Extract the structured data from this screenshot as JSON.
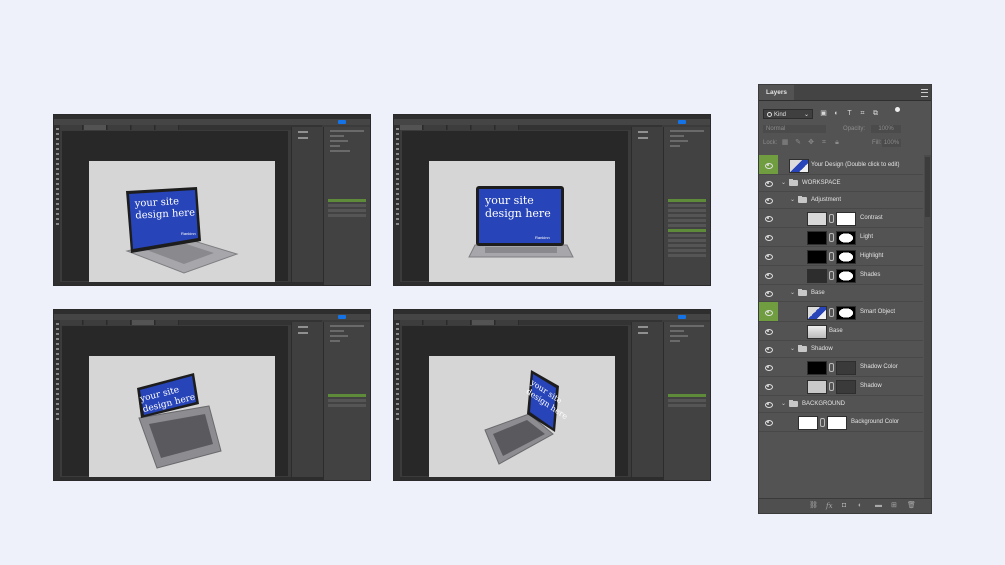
{
  "mockups": [
    {
      "screen_line1": "your site",
      "screen_line2": "design here",
      "brand": "Rankinn",
      "tilt": 0
    },
    {
      "screen_line1": "your site",
      "screen_line2": "design here",
      "brand": "Rankinn",
      "tilt": 0
    },
    {
      "screen_line1": "your site",
      "screen_line2": "design here",
      "brand": "",
      "tilt": 0
    },
    {
      "screen_line1": "your site",
      "screen_line2": "design here",
      "brand": "",
      "tilt": 0
    }
  ],
  "layers_panel": {
    "tab_title": "Layers",
    "filter_kind": "Kind",
    "blend_mode": "Normal",
    "opacity_label": "Opacity:",
    "opacity_value": "100%",
    "lock_label": "Lock:",
    "fill_label": "Fill:",
    "fill_value": "100%",
    "icons": {
      "menu": "panel-menu-icon",
      "search": "search-icon",
      "filter_pixel": "image-icon",
      "filter_adjust": "adjustment-icon",
      "filter_type": "type-icon",
      "filter_shape": "shape-icon",
      "filter_smart": "smart-object-icon"
    },
    "layers": [
      {
        "name": "Your Design  (Double click to edit)",
        "type": "smart",
        "depth": 0,
        "selected": true,
        "thumb": "design"
      },
      {
        "name": "WORKSPACE",
        "type": "group",
        "depth": 0,
        "selected": false
      },
      {
        "name": "Adjustment",
        "type": "group",
        "depth": 1,
        "selected": false
      },
      {
        "name": "Contrast",
        "type": "adjustment",
        "depth": 2,
        "selected": false,
        "thumb": "curves",
        "mask": "white"
      },
      {
        "name": "Light",
        "type": "adjustment",
        "depth": 2,
        "selected": false,
        "thumb": "black",
        "mask": "shape"
      },
      {
        "name": "Highlight",
        "type": "adjustment",
        "depth": 2,
        "selected": false,
        "thumb": "black",
        "mask": "shape"
      },
      {
        "name": "Shades",
        "type": "adjustment",
        "depth": 2,
        "selected": false,
        "thumb": "dark",
        "mask": "shape"
      },
      {
        "name": "Base",
        "type": "group",
        "depth": 1,
        "selected": false
      },
      {
        "name": "Smart Object",
        "type": "smart",
        "depth": 2,
        "selected": true,
        "thumb": "design",
        "mask": "shape"
      },
      {
        "name": "Base",
        "type": "pixel",
        "depth": 2,
        "selected": false,
        "thumb": "laptop"
      },
      {
        "name": "Shadow",
        "type": "group",
        "depth": 1,
        "selected": false
      },
      {
        "name": "Shadow Color",
        "type": "fill",
        "depth": 2,
        "selected": false,
        "thumb": "black",
        "mask": "dark"
      },
      {
        "name": "Shadow",
        "type": "pixel",
        "depth": 2,
        "selected": false,
        "thumb": "light",
        "mask": "dark"
      },
      {
        "name": "BACKGROUND",
        "type": "group",
        "depth": 0,
        "selected": false
      },
      {
        "name": "Background Color",
        "type": "fill",
        "depth": 1,
        "selected": false,
        "thumb": "white",
        "mask": "white"
      }
    ],
    "footer_icons": [
      "link-icon",
      "fx-icon",
      "mask-icon",
      "adjustment-layer-icon",
      "new-group-icon",
      "new-layer-icon",
      "trash-icon"
    ]
  },
  "colors": {
    "page_bg": "#eef0fa",
    "ps_dark": "#3b3b3b",
    "panel": "#535353",
    "selected_eye": "#6f9d3f",
    "screen_blue": "#2744b8"
  }
}
